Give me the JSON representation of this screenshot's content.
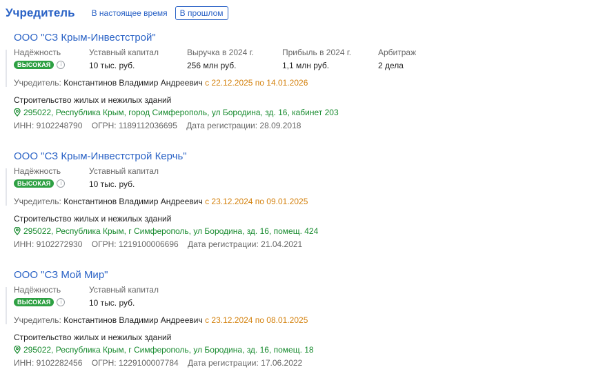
{
  "header": {
    "title": "Учредитель",
    "tab_present": "В настоящее время",
    "tab_past": "В прошлом"
  },
  "labels": {
    "reliability": "Надёжность",
    "capital": "Уставный капитал",
    "revenue": "Выручка в 2024 г.",
    "profit": "Прибыль в 2024 г.",
    "arbitration": "Арбитраж",
    "founder": "Учредитель:",
    "inn": "ИНН:",
    "ogrn": "ОГРН:",
    "reg_date": "Дата регистрации:"
  },
  "companies": [
    {
      "name": "ООО \"СЗ Крым-Инвестстрой\"",
      "reliability": "ВЫСОКАЯ",
      "capital": "10 тыс. руб.",
      "revenue": "256 млн руб.",
      "profit": "1,1 млн руб.",
      "arbitration": "2 дела",
      "founder": "Константинов Владимир Андреевич",
      "founder_period": "с 22.12.2025 по 14.01.2026",
      "activity": "Строительство жилых и нежилых зданий",
      "address": "295022, Республика Крым, город Симферополь, ул Бородина, зд. 16, кабинет 203",
      "inn": "9102248790",
      "ogrn": "1189112036695",
      "reg_date": "28.09.2018"
    },
    {
      "name": "ООО \"СЗ Крым-Инвестстрой Керчь\"",
      "reliability": "ВЫСОКАЯ",
      "capital": "10 тыс. руб.",
      "founder": "Константинов Владимир Андреевич",
      "founder_period": "с 23.12.2024 по 09.01.2025",
      "activity": "Строительство жилых и нежилых зданий",
      "address": "295022, Республика Крым, г Симферополь, ул Бородина, зд. 16, помещ. 424",
      "inn": "9102272930",
      "ogrn": "1219100006696",
      "reg_date": "21.04.2021"
    },
    {
      "name": "ООО \"СЗ Мой Мир\"",
      "reliability": "ВЫСОКАЯ",
      "capital": "10 тыс. руб.",
      "founder": "Константинов Владимир Андреевич",
      "founder_period": "с 23.12.2024 по 08.01.2025",
      "activity": "Строительство жилых и нежилых зданий",
      "address": "295022, Республика Крым, г Симферополь, ул Бородина, зд. 16, помещ. 18",
      "inn": "9102282456",
      "ogrn": "1229100007784",
      "reg_date": "17.06.2022"
    }
  ],
  "icons": {
    "info": "info-icon",
    "location": "location-pin-icon"
  },
  "colors": {
    "link": "#2b63c6",
    "badge": "#2ea043",
    "period": "#d4820f",
    "address": "#178a2e"
  }
}
